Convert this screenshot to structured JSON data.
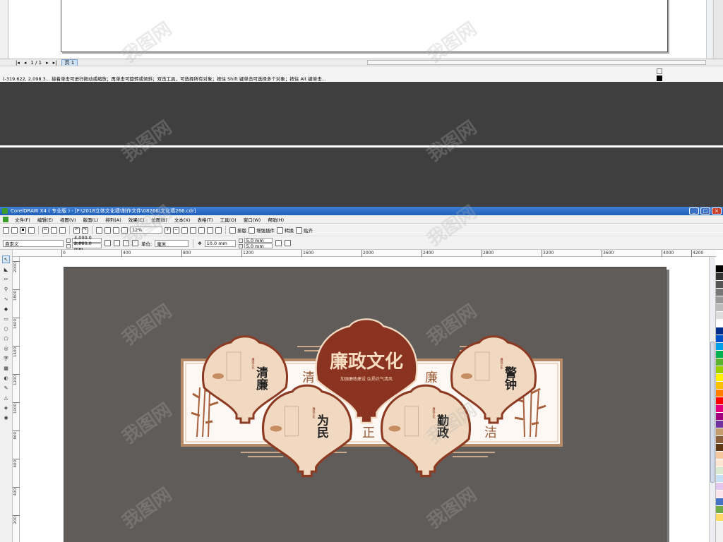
{
  "top": {
    "page_counter": "1 / 1",
    "page_tab": "页 1",
    "status_text": "(-319.622, 2,098.3...   接着单击可进行拖动或缩放；再单击可旋转或倾斜；双击工具，可选择所有对象；按住 Shift 键单击可选择多个对象；按住 Alt 键单击..."
  },
  "window": {
    "title": "CorelDRAW X4 ( 专业版 ) - [F:\\2018立体文化墙\\制作文件\\08266\\文化墙266.cdr]",
    "btn_min": "_",
    "btn_max": "□",
    "btn_close": "×"
  },
  "menu": [
    "文件(F)",
    "编辑(E)",
    "视图(V)",
    "版面(L)",
    "排列(A)",
    "效果(C)",
    "位图(B)",
    "文本(X)",
    "表格(T)",
    "工具(O)",
    "窗口(W)",
    "帮助(H)"
  ],
  "toolbar1": {
    "zoom": "12%",
    "btn_typeset": "排版",
    "btn_plugin": "增强插件",
    "btn_convert": "转换",
    "btn_paste": "贴齐"
  },
  "toolbar2": {
    "preset": "自定义",
    "width": "4,000.0 mm",
    "height": "2,000.0 mm",
    "unit_label": "单位:",
    "unit": "毫米",
    "nudge": "10.0 mm",
    "dup_x": "5.0 mm",
    "dup_y": "5.0 mm"
  },
  "ruler_h": [
    "0",
    "400",
    "800",
    "1200",
    "1600",
    "2000",
    "2400",
    "2800",
    "3200",
    "3600",
    "4000",
    "4200"
  ],
  "ruler_v": [
    "2000",
    "1800",
    "1600",
    "1400",
    "1200",
    "1000",
    "800",
    "600",
    "400",
    "200"
  ],
  "ruler_v_top": [
    "200"
  ],
  "artwork": {
    "title": "廉政文化",
    "subtitle": "加强廉政建设  弘扬正气清风",
    "leaf1": "清廉",
    "leaf2": "为民",
    "leaf3": "勤政",
    "leaf4": "警钟",
    "seal": "廉政文化",
    "big_chars": [
      "清",
      "正",
      "廉",
      "洁"
    ],
    "colors": {
      "frame": "#b88b68",
      "leaf_fill": "#f1d9c1",
      "leaf_border": "#8c3a22",
      "title_bg": "#8a3320",
      "title_text": "#f6dcc0",
      "char": "#9a5a36"
    }
  },
  "palette_colors": [
    "#000000",
    "#333333",
    "#555555",
    "#777777",
    "#999999",
    "#bbbbbb",
    "#dddddd",
    "#ffffff",
    "#002e8a",
    "#0050c8",
    "#00a0e9",
    "#00b050",
    "#5cb531",
    "#9bd000",
    "#fff100",
    "#ffc000",
    "#ff7f00",
    "#ff0000",
    "#e4007f",
    "#a0007f",
    "#7030a0",
    "#c69c6d",
    "#8b5e3c",
    "#603813",
    "#f4c6a0",
    "#ffe6d2",
    "#d9ead3",
    "#c5e0f5",
    "#e2c6f0",
    "#fce4ec",
    "#4472c4",
    "#70ad47",
    "#ffd966"
  ],
  "watermark": "我图网"
}
